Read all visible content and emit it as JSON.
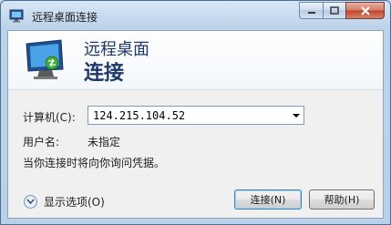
{
  "window": {
    "title": "远程桌面连接"
  },
  "banner": {
    "line1": "远程桌面",
    "line2": "连接"
  },
  "form": {
    "computer_label": "计算机(C):",
    "computer_value": "124.215.104.52",
    "username_label": "用户名:",
    "username_value": "未指定",
    "info_text": "当你连接时将向你询问凭据。"
  },
  "footer": {
    "show_options_label": "显示选项(O)",
    "connect_label": "连接(N)",
    "help_label": "帮助(H)"
  }
}
